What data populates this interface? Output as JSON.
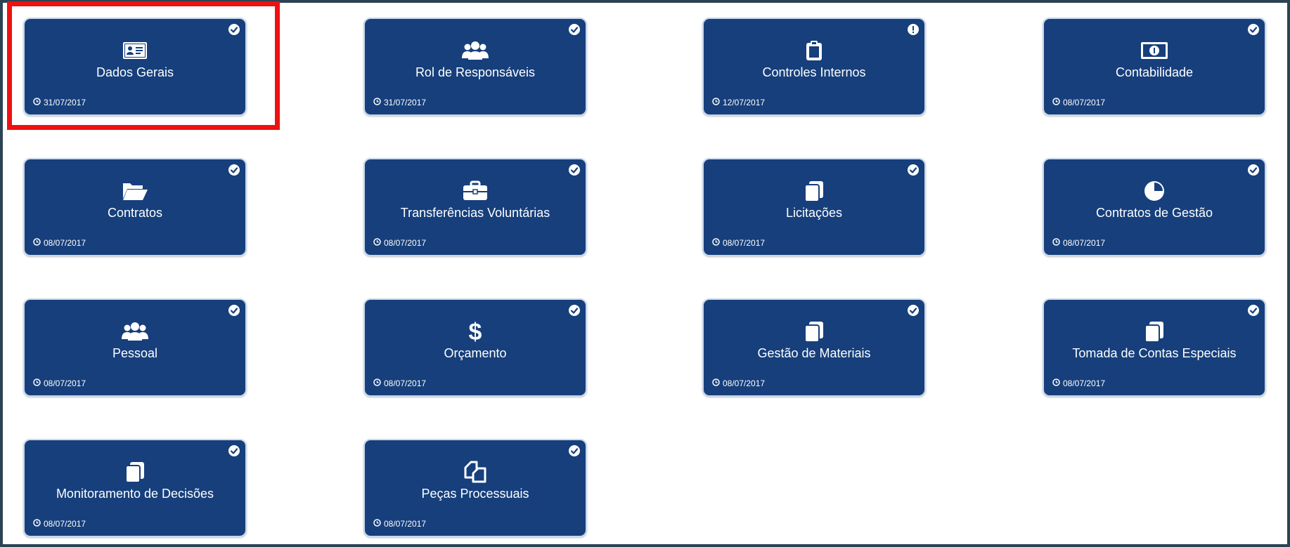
{
  "colors": {
    "card": "#163f7c",
    "frame": "#2b4354",
    "highlight": "#ee1111"
  },
  "cards": [
    {
      "title": "Dados Gerais",
      "date": "31/07/2017",
      "icon": "id-card-icon",
      "status": "check"
    },
    {
      "title": "Rol de Responsáveis",
      "date": "31/07/2017",
      "icon": "users-icon",
      "status": "check"
    },
    {
      "title": "Controles Internos",
      "date": "12/07/2017",
      "icon": "clipboard-icon",
      "status": "alert"
    },
    {
      "title": "Contabilidade",
      "date": "08/07/2017",
      "icon": "money-icon",
      "status": "check"
    },
    {
      "title": "Contratos",
      "date": "08/07/2017",
      "icon": "folder-open-icon",
      "status": "check"
    },
    {
      "title": "Transferências Voluntárias",
      "date": "08/07/2017",
      "icon": "briefcase-icon",
      "status": "check"
    },
    {
      "title": "Licitações",
      "date": "08/07/2017",
      "icon": "copy-icon",
      "status": "check"
    },
    {
      "title": "Contratos de Gestão",
      "date": "08/07/2017",
      "icon": "pie-chart-icon",
      "status": "check"
    },
    {
      "title": "Pessoal",
      "date": "08/07/2017",
      "icon": "users-icon",
      "status": "check"
    },
    {
      "title": "Orçamento",
      "date": "08/07/2017",
      "icon": "dollar-icon",
      "status": "check"
    },
    {
      "title": "Gestão de Materiais",
      "date": "08/07/2017",
      "icon": "copy-icon",
      "status": "check"
    },
    {
      "title": "Tomada de Contas Especiais",
      "date": "08/07/2017",
      "icon": "copy-icon",
      "status": "check"
    },
    {
      "title": "Monitoramento de Decisões",
      "date": "08/07/2017",
      "icon": "copy-icon",
      "status": "check"
    },
    {
      "title": "Peças Processuais",
      "date": "08/07/2017",
      "icon": "files-icon",
      "status": "check"
    }
  ]
}
